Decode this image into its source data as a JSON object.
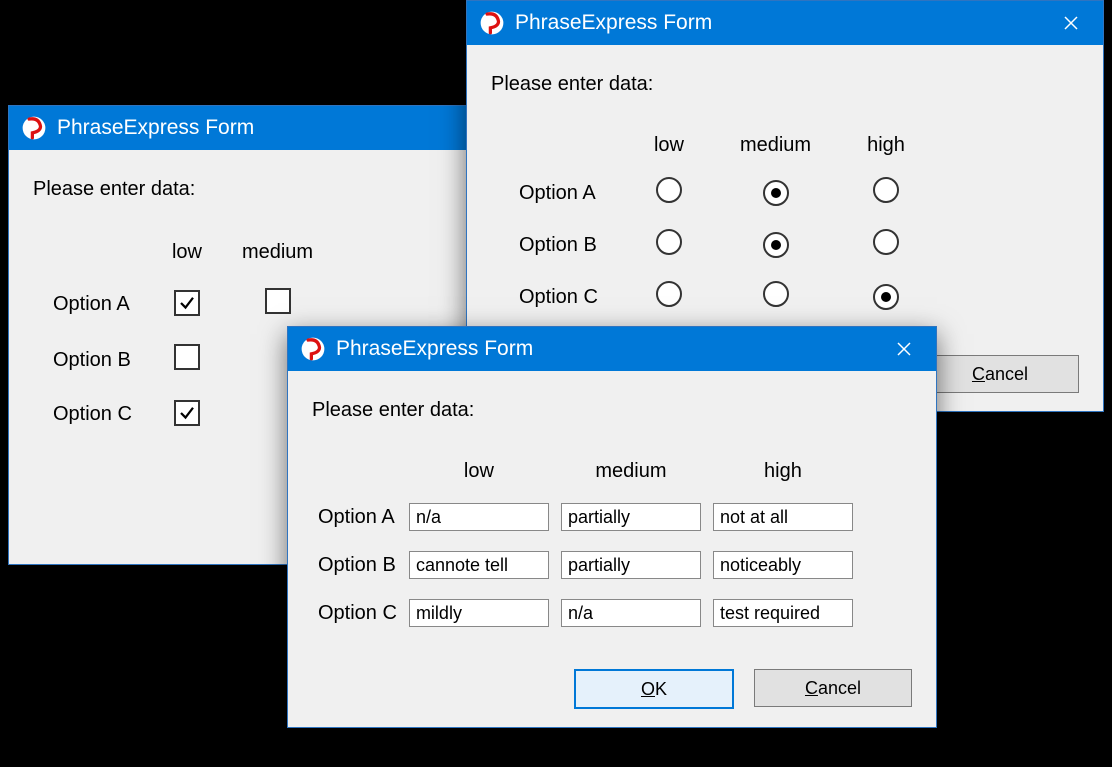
{
  "app": {
    "title": "PhraseExpress Form"
  },
  "prompt": "Please enter data:",
  "columns": [
    "low",
    "medium",
    "high"
  ],
  "rows": [
    "Option A",
    "Option B",
    "Option C"
  ],
  "buttons": {
    "ok": "OK",
    "cancel": "Cancel"
  },
  "winA": {
    "visible_columns": [
      "low",
      "medium"
    ],
    "checks": {
      "Option A": {
        "low": true,
        "medium": false
      },
      "Option B": {
        "low": false,
        "medium": null
      },
      "Option C": {
        "low": true,
        "medium": null
      }
    }
  },
  "winB": {
    "radios": {
      "Option A": "medium",
      "Option B": "medium",
      "Option C": "high"
    }
  },
  "winC": {
    "texts": {
      "Option A": {
        "low": "n/a",
        "medium": "partially",
        "high": "not at all"
      },
      "Option B": {
        "low": "cannote tell",
        "medium": "partially",
        "high": "noticeably"
      },
      "Option C": {
        "low": "mildly",
        "medium": "n/a",
        "high": "test required"
      }
    }
  }
}
